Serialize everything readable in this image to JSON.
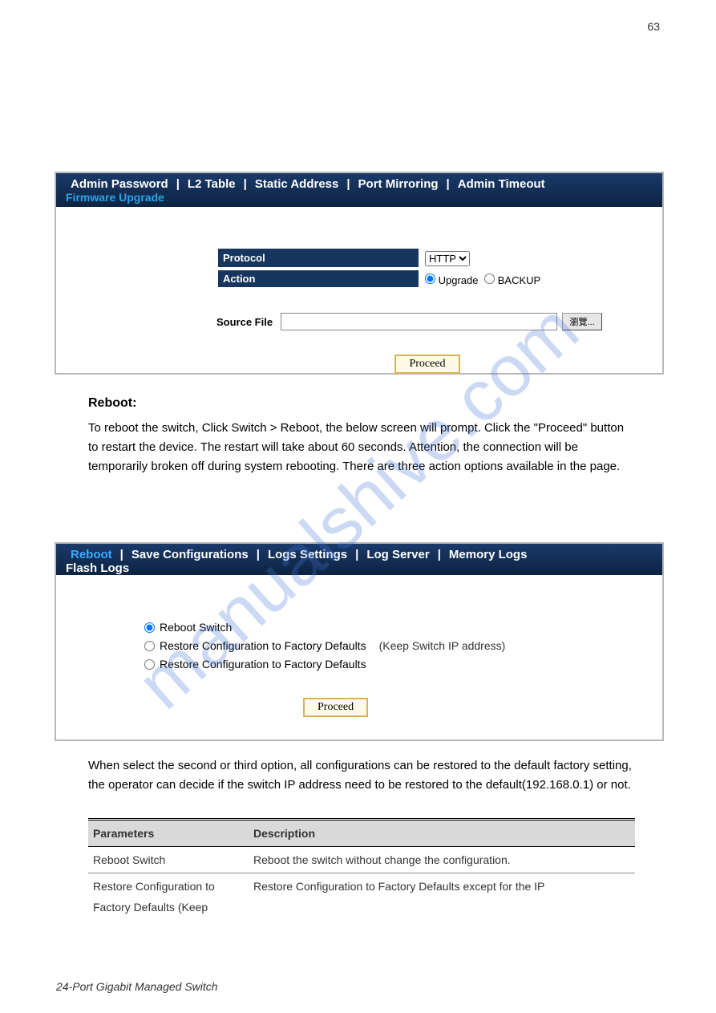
{
  "page": {
    "number": "63",
    "footer": "24-Port Gigabit Managed Switch"
  },
  "watermark": "manualshive.com",
  "panel1": {
    "nav": [
      "Admin Password",
      "L2 Table",
      "Static Address",
      "Port Mirroring",
      "Admin Timeout"
    ],
    "subnav": "Firmware Upgrade",
    "protocol_label": "Protocol",
    "protocol_value": "HTTP",
    "action_label": "Action",
    "action_opt1": "Upgrade",
    "action_opt2": "BACKUP",
    "sourcefile_label": "Source File",
    "browse_label": "瀏覽...",
    "proceed_label": "Proceed"
  },
  "text1": {
    "heading": "Reboot:",
    "body": "To reboot the switch, Click Switch > Reboot, the below screen will prompt. Click the \"Proceed\" button to restart the device. The restart will take about 60 seconds. Attention, the connection will be temporarily broken off during system rebooting. There are three action options available in the page."
  },
  "panel2": {
    "nav": [
      "Reboot",
      "Save Configurations",
      "Logs Settings",
      "Log Server",
      "Memory Logs"
    ],
    "subnav": "Flash Logs",
    "radio1": "Reboot Switch",
    "radio2": "Restore Configuration to Factory Defaults",
    "radio2_extra": "(Keep Switch IP address)",
    "radio3": "Restore Configuration to Factory Defaults",
    "proceed_label": "Proceed"
  },
  "text2": {
    "body": "When select the second or third option, all configurations can be restored to the default factory setting, the operator can decide if the switch IP address need to be restored to the default(192.168.0.1) or not."
  },
  "table": {
    "head_param": "Parameters",
    "head_desc": "Description",
    "row1_param": "Reboot Switch",
    "row1_desc": "Reboot the switch without change the configuration.",
    "row2_param": "Restore Configuration to",
    "row2_desc": "Restore Configuration to Factory Defaults except for the IP",
    "row2b_param": "Factory Defaults (Keep"
  }
}
